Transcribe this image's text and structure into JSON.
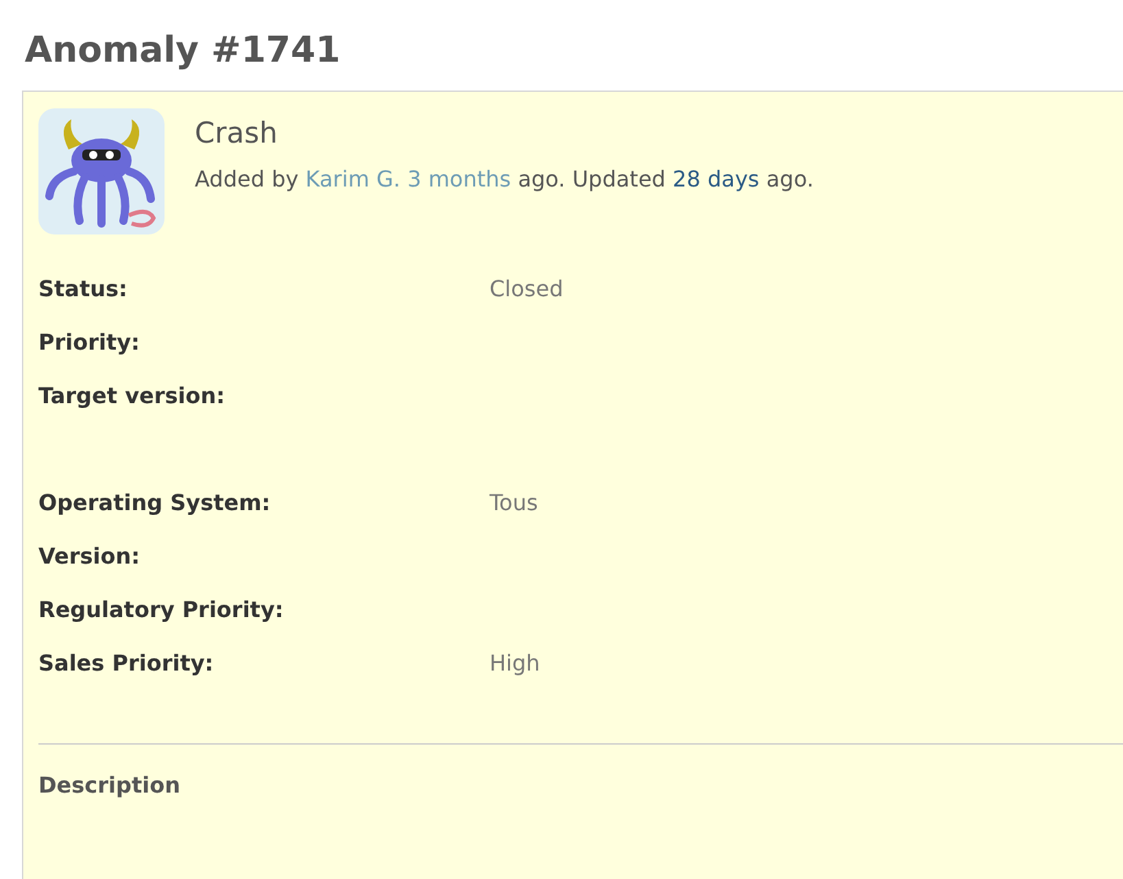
{
  "title": "Anomaly #1741",
  "issue": {
    "subject": "Crash",
    "byline": [
      {
        "kind": "text",
        "text": "Added by"
      },
      {
        "kind": "link",
        "text": "Karim G.",
        "visited": true
      },
      {
        "kind": "link",
        "text": "3 months",
        "visited": true
      },
      {
        "kind": "text",
        "text": "ago. Updated"
      },
      {
        "kind": "link",
        "text": "28 days",
        "visited": false
      },
      {
        "kind": "text",
        "text": "ago."
      }
    ],
    "field_groups": [
      [
        {
          "label": "Status:",
          "value": "Closed"
        },
        {
          "label": "Priority:"
        },
        {
          "label": "Target version:"
        }
      ],
      [
        {
          "label": "Operating System:",
          "value": "Tous"
        },
        {
          "label": "Version:"
        },
        {
          "label": "Regulatory Priority:"
        },
        {
          "label": "Sales Priority:",
          "value": "High"
        }
      ]
    ],
    "description_heading": "Description"
  }
}
